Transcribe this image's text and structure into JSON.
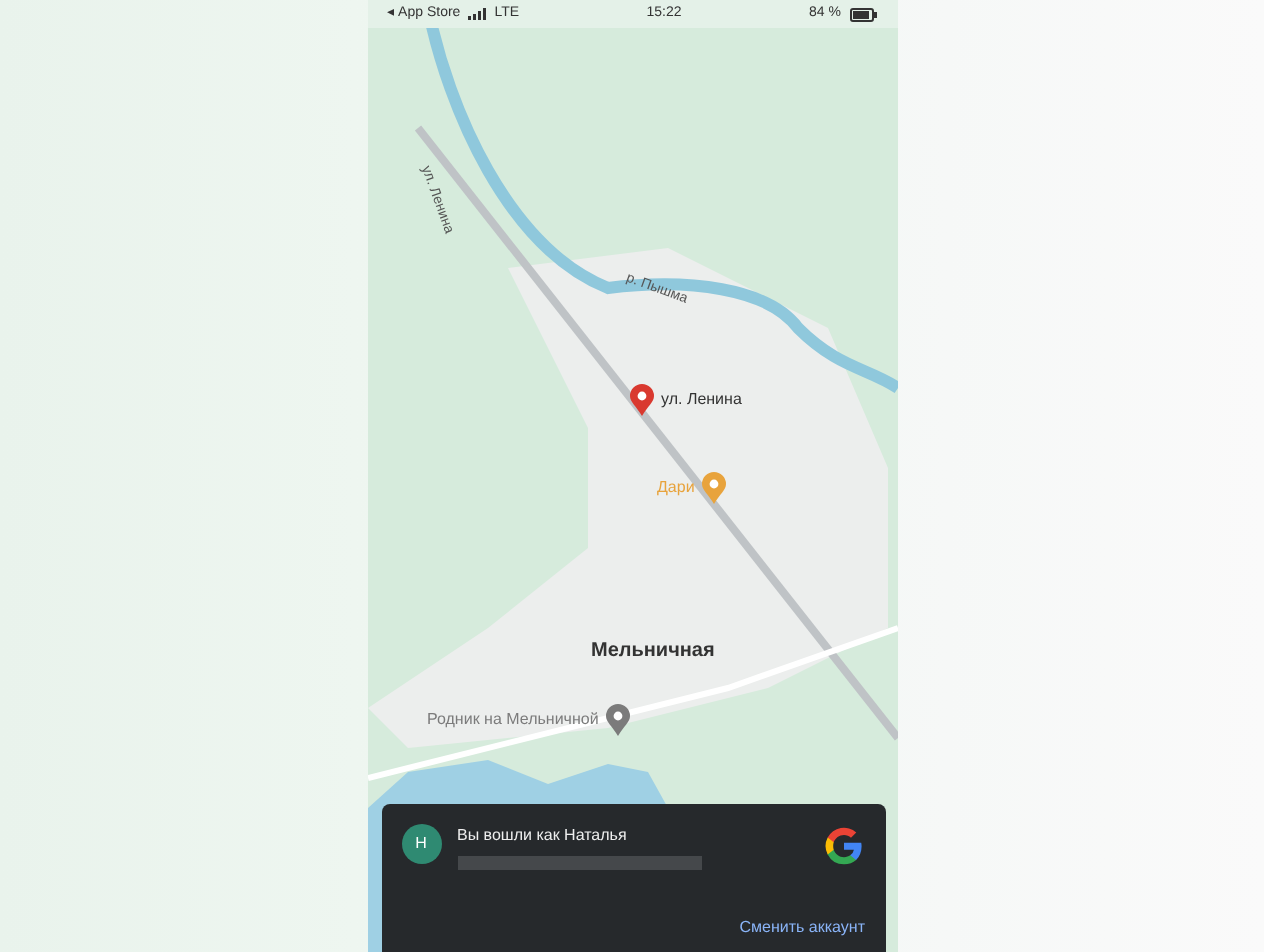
{
  "status_bar": {
    "back": "◂ App Store",
    "network": "LTE",
    "time": "15:22",
    "battery": "84 %"
  },
  "map": {
    "road_labels": [
      "ул. Ленина",
      "р. Пышма"
    ],
    "pins": [
      {
        "label": "ул. Ленина",
        "kind": "address",
        "color": "#d9392f"
      },
      {
        "label": "Дари",
        "kind": "place",
        "color": "#e8a33c"
      },
      {
        "label": "Родник на Мельничной",
        "kind": "place",
        "color": "#7b7b7b"
      }
    ],
    "area_label": "Мельничная"
  },
  "toast": {
    "avatar": "Н",
    "title": "Вы вошли как Наталья",
    "action": "Сменить аккаунт"
  }
}
